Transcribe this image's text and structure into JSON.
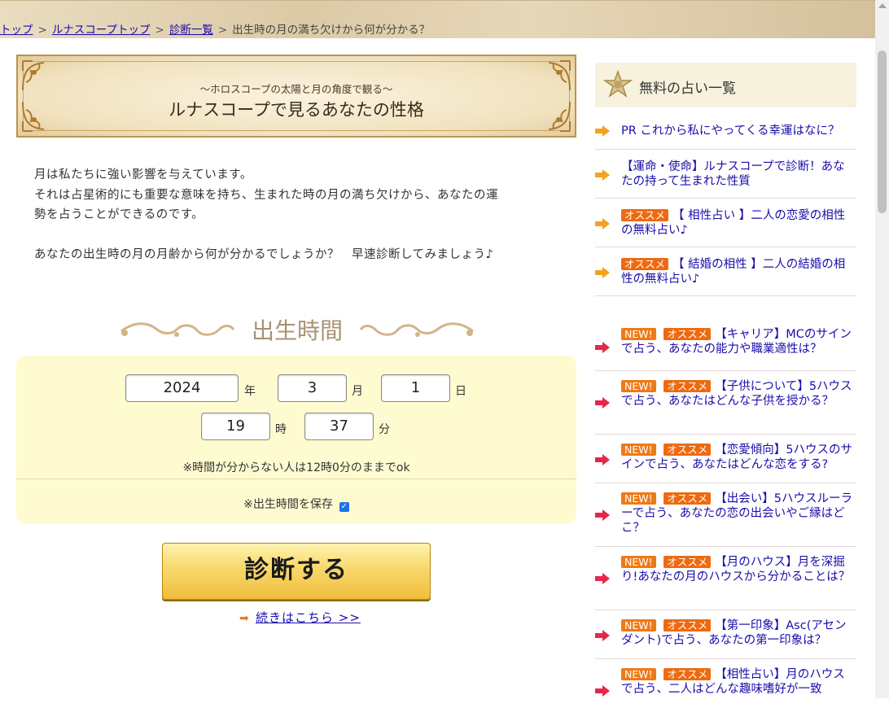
{
  "breadcrumb": {
    "items": [
      "トップ",
      "ルナスコープトップ",
      "診断一覧"
    ],
    "current": "出生時の月の満ち欠けから何が分かる？",
    "separator": ">"
  },
  "banner": {
    "subtitle": "〜ホロスコープの太陽と月の角度で観る〜",
    "title": "ルナスコープで見るあなたの性格"
  },
  "intro": {
    "line1": "月は私たちに強い影響を与えています。",
    "line2": "それは占星術的にも重要な意味を持ち、生まれた時の月の満ち欠けから、あなたの運",
    "line3": "勢を占うことができるのです。",
    "line4": "あなたの出生時の月の月齢から何が分かるでしょうか？　早速診断してみましょう♪"
  },
  "form": {
    "section_title": "出生時間",
    "year": "2024",
    "year_unit": "年",
    "month": "3",
    "month_unit": "月",
    "day": "1",
    "day_unit": "日",
    "hour": "19",
    "hour_unit": "時",
    "minute": "37",
    "minute_unit": "分",
    "note": "※時間が分からない人は12時0分のままでok",
    "save_label": "※出生時間を保存",
    "save_checked": true,
    "submit_label": "診断する",
    "more_link": "続きはこちら >>"
  },
  "sidebar": {
    "heading": "無料の占い一覧",
    "badges": {
      "new": "NEW!",
      "recommend": "オススメ"
    },
    "items": [
      {
        "text": "PR これから私にやってくる幸運はなに？"
      },
      {
        "text": "【運命・使命】ルナスコープで診断！あなたの持って生まれた性質"
      },
      {
        "text": "【 相性占い 】二人の恋愛の相性の無料占い♪"
      },
      {
        "text": "【 結婚の相性 】二人の結婚の相性の無料占い♪"
      },
      {
        "text": "【キャリア】MCのサインで占う、あなたの能力や職業適性は？"
      },
      {
        "text": "【子供について】5ハウスで占う、あなたはどんな子供を授かる？"
      },
      {
        "text": "【恋愛傾向】5ハウスのサインで占う、あなたはどんな恋をする?"
      },
      {
        "text": "【出会い】5ハウスルーラーで占う、あなたの恋の出会いやご縁はどこ？"
      },
      {
        "text": "【月のハウス】月を深掘り!あなたの月のハウスから分かることは？"
      },
      {
        "text": "【第一印象】Asc(アセンダント)で占う、あなたの第一印象は？"
      },
      {
        "text": "【相性占い】月のハウスで占う、二人はどんな趣味嗜好が一致"
      }
    ]
  },
  "colors": {
    "link": "#1a0dab",
    "badge_orange": "#ee7a16",
    "panel_bg": "#fffbd0",
    "arrow_orange": "#f4a21f",
    "arrow_red": "#e8264b"
  }
}
